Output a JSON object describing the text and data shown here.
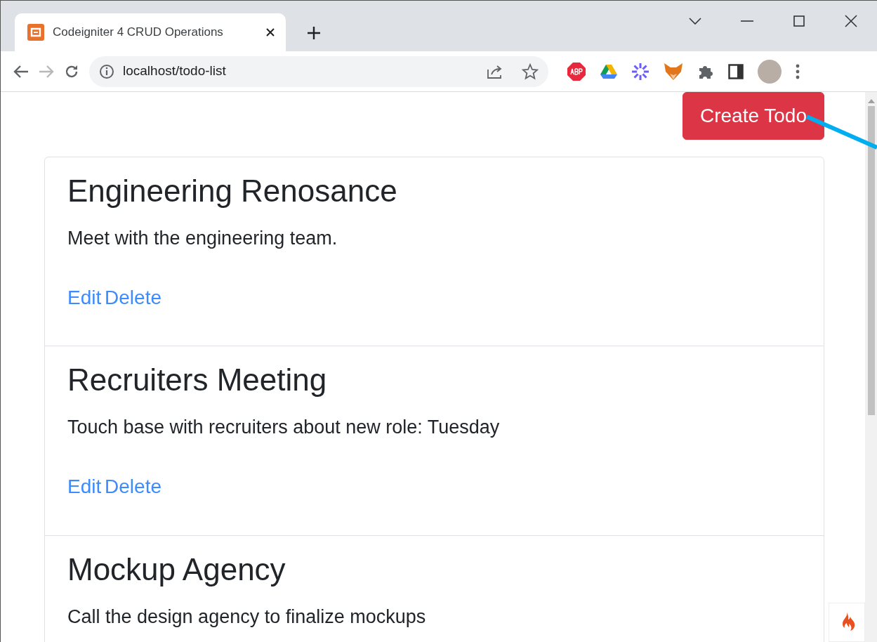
{
  "browser": {
    "tab": {
      "title": "Codeigniter 4 CRUD Operations"
    },
    "address": "localhost/todo-list"
  },
  "page": {
    "create_button": "Create Todo",
    "todos": [
      {
        "title": "Engineering Renosance",
        "description": "Meet with the engineering team.",
        "actions": [
          "Edit",
          "Delete"
        ]
      },
      {
        "title": "Recruiters Meeting",
        "description": "Touch base with recruiters about new role: Tuesday",
        "actions": [
          "Edit",
          "Delete"
        ]
      },
      {
        "title": "Mockup Agency",
        "description": "Call the design agency to finalize mockups"
      }
    ]
  }
}
